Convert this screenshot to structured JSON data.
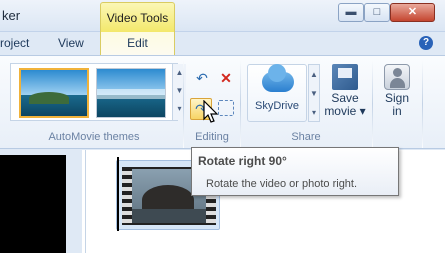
{
  "window": {
    "title_fragment": "ker",
    "context_tab": "Video Tools",
    "minimize_glyph": "▬",
    "maximize_glyph": "□",
    "close_glyph": "✕"
  },
  "tabs": [
    {
      "label": "roject"
    },
    {
      "label": "View"
    },
    {
      "label": "Edit",
      "active": true
    }
  ],
  "help_glyph": "?",
  "ribbon": {
    "groups": [
      {
        "label": "AutoMovie themes"
      },
      {
        "label": "Editing"
      },
      {
        "label": "Share"
      }
    ],
    "gallery_scroll": [
      "▲",
      "▼",
      "▾"
    ],
    "share_scroll": [
      "▲",
      "▼",
      "▾"
    ],
    "editing_icons": {
      "rotate_left": "↶",
      "remove": "✕",
      "rotate_right": "↷"
    },
    "skydrive_label": "SkyDrive",
    "save_movie_label_1": "Save",
    "save_movie_label_2": "movie ▾",
    "sign_in_label_1": "Sign",
    "sign_in_label_2": "in"
  },
  "tooltip": {
    "title": "Rotate right 90°",
    "description": "Rotate the video or photo right."
  },
  "colors": {
    "context_tab": "#f3e86b",
    "ribbon": "#e8eff8",
    "close_button": "#c4452f",
    "highlight_button": "#f7d466"
  },
  "icons": [
    "rotate-left-icon",
    "remove-icon",
    "rotate-right-icon",
    "select-all-icon",
    "skydrive-cloud-icon",
    "save-movie-icon",
    "sign-in-icon",
    "help-icon",
    "mouse-cursor-icon"
  ]
}
